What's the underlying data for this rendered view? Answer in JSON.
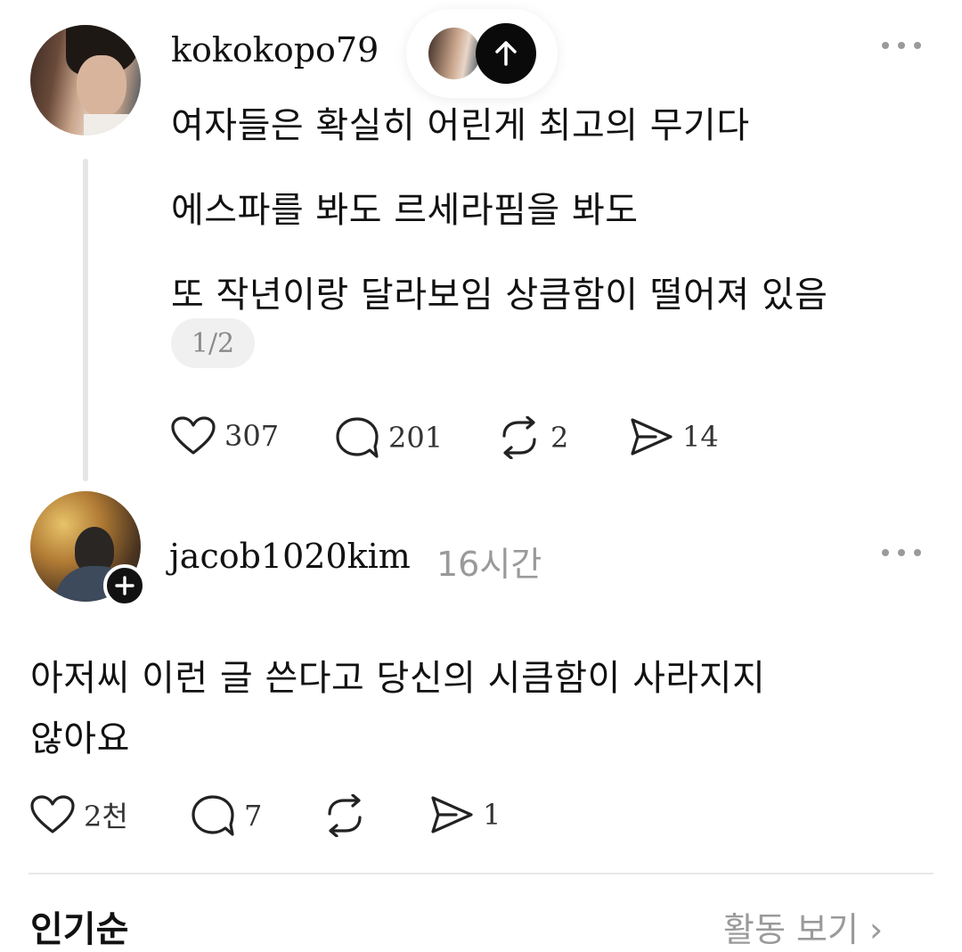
{
  "post1": {
    "username": "kokokopo79",
    "lines": [
      "여자들은 확실히 어린게 최고의 무기다",
      "에스파를 봐도 르세라핌을 봐도",
      "또 작년이랑 달라보임 상큼함이 떨어져 있음"
    ],
    "pager": "1/2",
    "actions": {
      "like_icon": "heart-icon",
      "like_count": "307",
      "comment_icon": "comment-bubble-icon",
      "comment_count": "201",
      "repost_icon": "repost-icon",
      "repost_count": "2",
      "share_icon": "send-icon",
      "share_count": "14"
    }
  },
  "reply": {
    "username": "jacob1020kim",
    "timestamp": "16시간",
    "lines": [
      "아저씨 이런 글 쓴다고 당신의 시큼함이 사라지지",
      "않아요"
    ],
    "actions": {
      "like_icon": "heart-icon",
      "like_count": "2천",
      "comment_icon": "comment-bubble-icon",
      "comment_count": "7",
      "repost_icon": "repost-icon",
      "repost_count": "",
      "share_icon": "send-icon",
      "share_count": "1"
    }
  },
  "footer": {
    "left_label": "인기순",
    "right_label": "활동 보기 ›"
  },
  "colors": {
    "text": "#111111",
    "muted": "#9a9a9a",
    "divider": "#e8e8e8",
    "pager_bg": "#f0f0f0",
    "button_dark": "#0a0a0a"
  }
}
